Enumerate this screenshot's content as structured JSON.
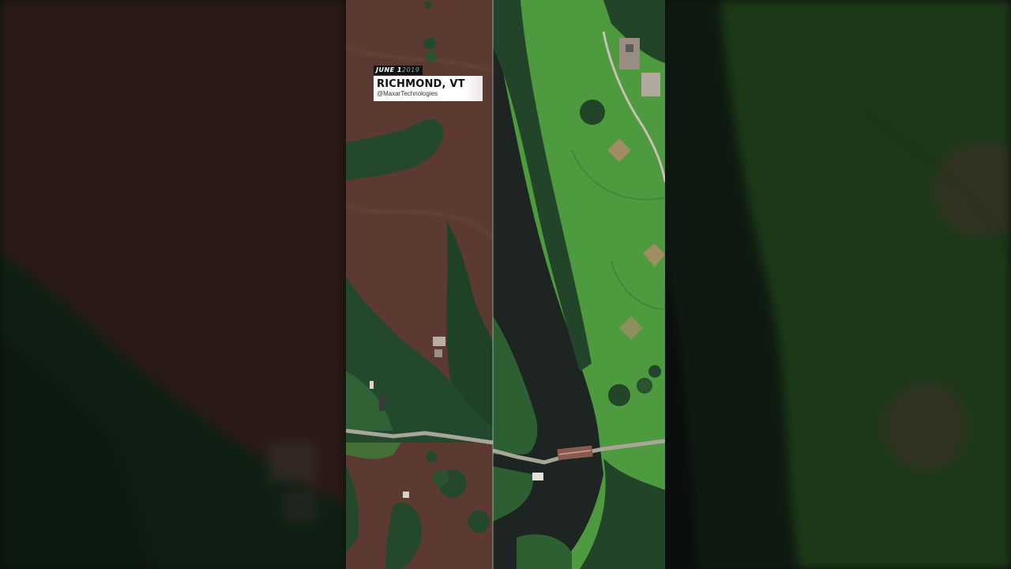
{
  "caption": {
    "date_main": "JUNE 1",
    "date_faded": "2019",
    "location": "RICHMOND, VT",
    "credit": "@MaxarTechnologies"
  },
  "colors": {
    "floodwater": "#5c3a32",
    "river": "#1d2422",
    "grass": "#4e9a3f",
    "trees": "#22452a",
    "bridge": "#8a5a4c",
    "road": "#a9a59a"
  }
}
